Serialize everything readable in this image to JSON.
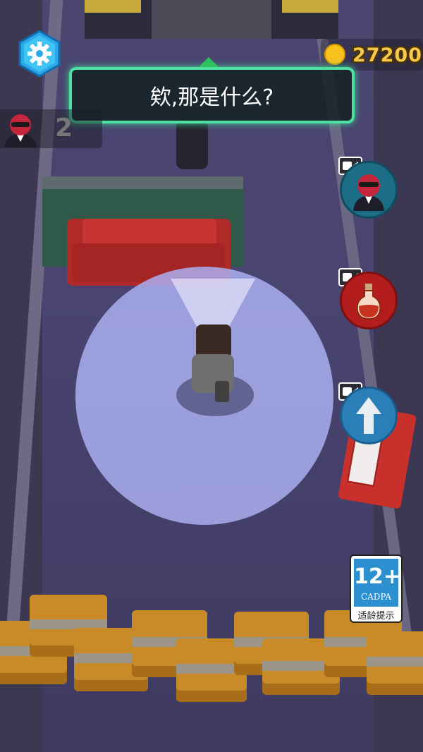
{
  "hud": {
    "coins": "27200",
    "kill_count": "2",
    "dialog_text": "欸,那是什么?",
    "settings_icon": "gear-icon",
    "coin_icon": "coin-icon"
  },
  "power_ups": [
    {
      "name": "disguise-powerup",
      "icon": "agent-avatar-icon",
      "ad_icon": "video-camera-icon"
    },
    {
      "name": "potion-powerup",
      "icon": "potion-bottle-icon",
      "ad_icon": "video-camera-icon"
    },
    {
      "name": "speed-powerup",
      "icon": "up-arrow-icon",
      "ad_icon": "video-camera-icon"
    }
  ],
  "age_rating": {
    "age": "12+",
    "org": "CADPA",
    "tip": "适龄提示"
  },
  "colors": {
    "accent_green": "#4de0a0",
    "coin_gold": "#f7c21e",
    "settings_blue": "#2aa8e8",
    "powerup_teal": "#1b6e86",
    "powerup_red": "#b31d1d",
    "powerup_blue": "#2b7fb8"
  }
}
